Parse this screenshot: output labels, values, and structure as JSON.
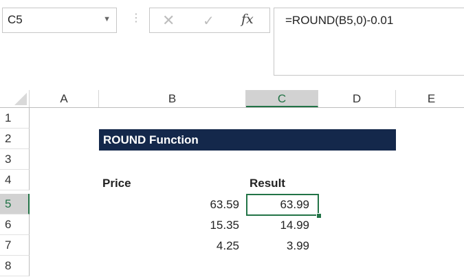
{
  "formula_bar": {
    "name_box": "C5",
    "name_box_dropdown_icon": "chevron-down-icon",
    "dots_icon": "vertical-dots-icon",
    "cancel_icon": "close-icon",
    "enter_icon": "check-icon",
    "fx_label": "fx",
    "formula": "=ROUND(B5,0)-0.01"
  },
  "columns": [
    {
      "label": "A",
      "active": false
    },
    {
      "label": "B",
      "active": false
    },
    {
      "label": "C",
      "active": true
    },
    {
      "label": "D",
      "active": false
    },
    {
      "label": "E",
      "active": false
    }
  ],
  "rows": [
    "1",
    "2",
    "3",
    "4",
    "5",
    "6",
    "7",
    "8"
  ],
  "active_row": "5",
  "active_cell": "C5",
  "colors": {
    "title_band": "#14284b",
    "title_text": "#ffffff",
    "selection": "#217346"
  },
  "cells": {
    "B2": "ROUND Function",
    "B4": "Price",
    "C4": "Result",
    "B5": "63.59",
    "C5": "63.99",
    "B6": "15.35",
    "C6": "14.99",
    "B7": "4.25",
    "C7": "3.99"
  }
}
